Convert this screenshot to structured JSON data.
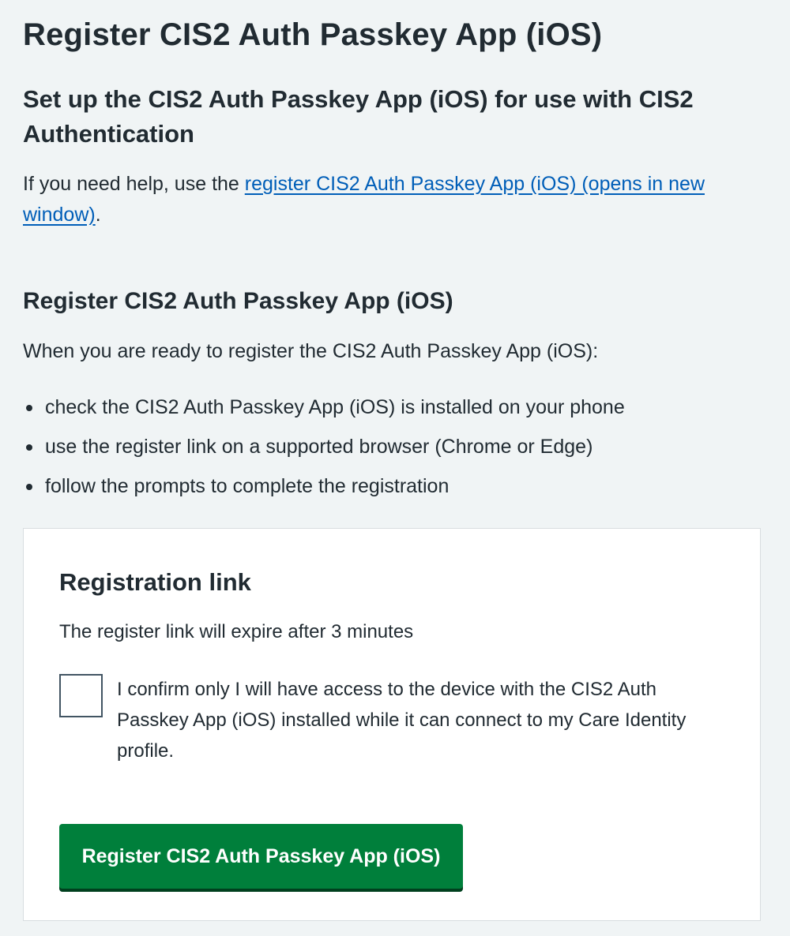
{
  "page": {
    "title": "Register CIS2 Auth Passkey App (iOS)",
    "subtitle": "Set up the CIS2 Auth Passkey App (iOS) for use with CIS2 Authentication",
    "help": {
      "prefix": "If you need help, use the ",
      "link_text": "register CIS2 Auth Passkey App (iOS) (opens in new window)",
      "suffix": "."
    }
  },
  "section": {
    "title": "Register CIS2 Auth Passkey App (iOS)",
    "intro": "When you are ready to register the CIS2 Auth Passkey App (iOS):",
    "steps": [
      "check the CIS2 Auth Passkey App (iOS) is installed on your phone",
      "use the register link on a supported browser (Chrome or Edge)",
      "follow the prompts to complete the registration"
    ]
  },
  "card": {
    "title": "Registration link",
    "expire_text": "The register link will expire after 3 minutes",
    "confirm_label": "I confirm only I will have access to the device with the CIS2 Auth Passkey App (iOS) installed while it can connect to my Care Identity profile.",
    "confirm_checked": false,
    "button_label": "Register CIS2 Auth Passkey App (iOS)"
  },
  "colors": {
    "background": "#f0f4f5",
    "text": "#212b32",
    "link": "#005eb8",
    "button": "#007f3b",
    "button_shadow": "#00401e",
    "card_border": "#d8dde0"
  }
}
